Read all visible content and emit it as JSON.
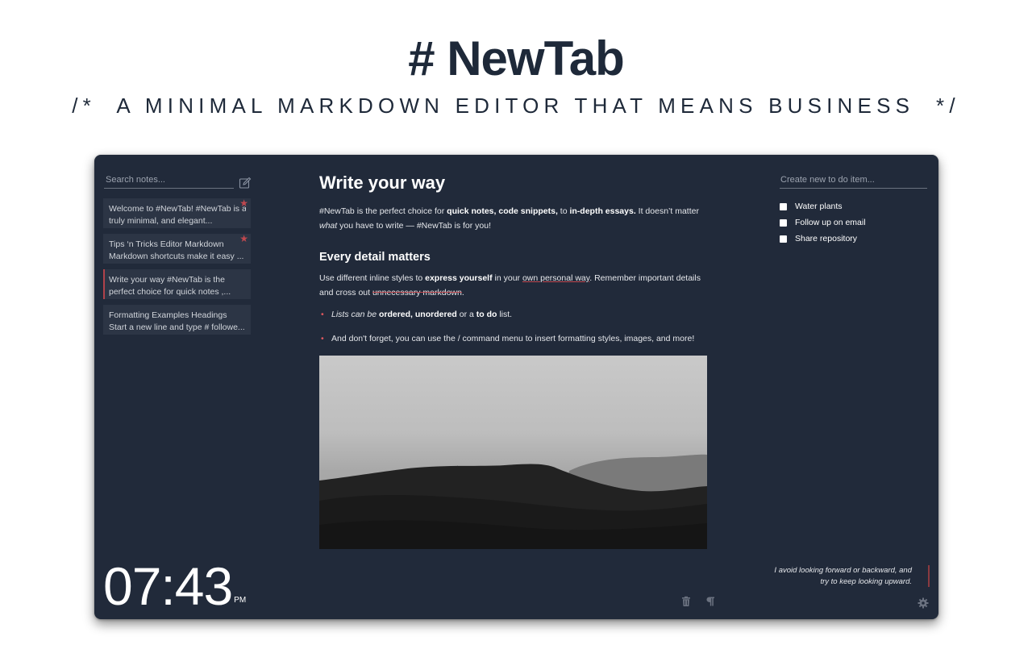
{
  "hero": {
    "title": "# NewTab",
    "subtitle": "/*  A MINIMAL MARKDOWN EDITOR THAT MEANS BUSINESS  */"
  },
  "sidebar": {
    "search_placeholder": "Search notes...",
    "new_note_icon": "edit-icon",
    "notes": [
      {
        "line1": "Welcome to #NewTab! #NewTab is a",
        "line2": "truly minimal, and elegant...",
        "starred": true,
        "active": false
      },
      {
        "line1": "Tips ‘n Tricks Editor Markdown",
        "line2": "Markdown shortcuts make it easy ...",
        "starred": true,
        "active": false
      },
      {
        "line1": "Write your way #NewTab is the",
        "line2": "perfect choice for quick notes ,...",
        "starred": false,
        "active": true
      },
      {
        "line1": "Formatting Examples Headings",
        "line2": "Start a new line and type # followe...",
        "starred": false,
        "active": false
      }
    ],
    "star_glyph": "★"
  },
  "clock": {
    "time": "07:43",
    "ampm": "PM"
  },
  "editor": {
    "title": "Write your way",
    "p1": {
      "t1": "#NewTab is the perfect choice for ",
      "b1": "quick notes, code snippets,",
      "t2": " to ",
      "b2": "in-depth essays.",
      "t3": " It doesn’t matter ",
      "i1": "what",
      "t4": " you have to write — #NewTab is for you!"
    },
    "h2": "Every detail matters",
    "p2": {
      "t1": "Use different inline styles to ",
      "b1": "express yourself",
      "t2": " in your ",
      "u1": "own personal way",
      "t3": ". Remember important details and cross out ",
      "s1": "unnecessary markdown",
      "t4": "."
    },
    "list": [
      {
        "i": "Lists can be",
        "t1": " ",
        "b1": "ordered, unordered",
        "t2": " or a ",
        "b2": "to do",
        "t3": " list."
      },
      {
        "t1": " And don't forget, you can use the / command menu to insert formatting styles, images, and more!"
      }
    ],
    "image_alt": "Black and white desert dunes photograph",
    "tools": [
      "trash-icon",
      "pilcrow-icon"
    ]
  },
  "todo": {
    "placeholder": "Create new to do item...",
    "items": [
      {
        "label": "Water plants",
        "checked": false
      },
      {
        "label": "Follow up on email",
        "checked": false
      },
      {
        "label": "Share repository",
        "checked": false
      }
    ]
  },
  "quote": {
    "line1": "I avoid looking forward or backward, and",
    "line2": "try to keep looking upward."
  },
  "colors": {
    "window_bg": "#212a3a",
    "note_bg": "#2c3545",
    "accent": "#c0484f",
    "title_ink": "#1e2939"
  }
}
